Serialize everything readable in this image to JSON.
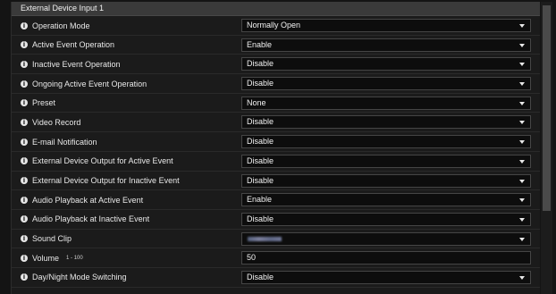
{
  "panel": {
    "title": "External Device Input 1"
  },
  "rows": [
    {
      "label": "Operation Mode",
      "value": "Normally Open",
      "type": "select"
    },
    {
      "label": "Active Event Operation",
      "value": "Enable",
      "type": "select"
    },
    {
      "label": "Inactive Event Operation",
      "value": "Disable",
      "type": "select"
    },
    {
      "label": "Ongoing Active Event Operation",
      "value": "Disable",
      "type": "select"
    },
    {
      "label": "Preset",
      "value": "None",
      "type": "select"
    },
    {
      "label": "Video Record",
      "value": "Disable",
      "type": "select"
    },
    {
      "label": "E-mail Notification",
      "value": "Disable",
      "type": "select"
    },
    {
      "label": "External Device Output for Active Event",
      "value": "Disable",
      "type": "select"
    },
    {
      "label": "External Device Output for Inactive Event",
      "value": "Disable",
      "type": "select"
    },
    {
      "label": "Audio Playback at Active Event",
      "value": "Enable",
      "type": "select"
    },
    {
      "label": "Audio Playback at Inactive Event",
      "value": "Disable",
      "type": "select"
    },
    {
      "label": "Sound Clip",
      "value": "",
      "type": "select"
    },
    {
      "label": "Volume",
      "range": "1 - 100",
      "value": "50",
      "type": "text"
    },
    {
      "label": "Day/Night Mode Switching",
      "value": "Disable",
      "type": "select"
    }
  ],
  "icons": {
    "info": "info-icon",
    "dropdown": "chevron-down-icon"
  },
  "colors": {
    "header_bg": "#3a3a3a",
    "panel_bg": "#1b1b1b",
    "field_bg": "#0d0d0d"
  }
}
